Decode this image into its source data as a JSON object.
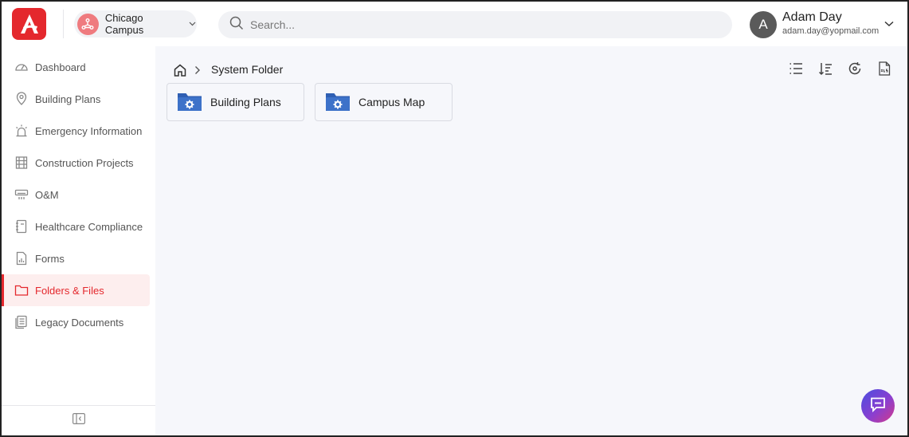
{
  "header": {
    "logo_icon": "brand-logo-icon",
    "campus_selector": {
      "label": "Chicago Campus",
      "icon": "campus-network-icon"
    },
    "search": {
      "placeholder": "Search...",
      "value": ""
    },
    "user": {
      "initial": "A",
      "name": "Adam Day",
      "email": "adam.day@yopmail.com"
    }
  },
  "sidebar": {
    "items": [
      {
        "label": "Dashboard",
        "icon": "gauge-icon",
        "active": false
      },
      {
        "label": "Building Plans",
        "icon": "map-pin-icon",
        "active": false
      },
      {
        "label": "Emergency Information",
        "icon": "alarm-light-icon",
        "active": false
      },
      {
        "label": "Construction Projects",
        "icon": "scaffold-icon",
        "active": false
      },
      {
        "label": "O&M",
        "icon": "air-conditioner-icon",
        "active": false
      },
      {
        "label": "Healthcare Compliance",
        "icon": "notebook-icon",
        "active": false
      },
      {
        "label": "Forms",
        "icon": "form-chart-icon",
        "active": false
      },
      {
        "label": "Folders & Files",
        "icon": "folder-icon",
        "active": true
      },
      {
        "label": "Legacy Documents",
        "icon": "documents-icon",
        "active": false
      }
    ],
    "collapse_icon": "sidebar-collapse-icon"
  },
  "breadcrumb": {
    "current": "System Folder"
  },
  "folders": [
    {
      "label": "Building Plans"
    },
    {
      "label": "Campus Map"
    }
  ],
  "colors": {
    "accent": "#e4282d",
    "folder_blue": "#3d6fc4",
    "chat_gradient_start": "#4a4ee0",
    "chat_gradient_end": "#d33a8a"
  }
}
